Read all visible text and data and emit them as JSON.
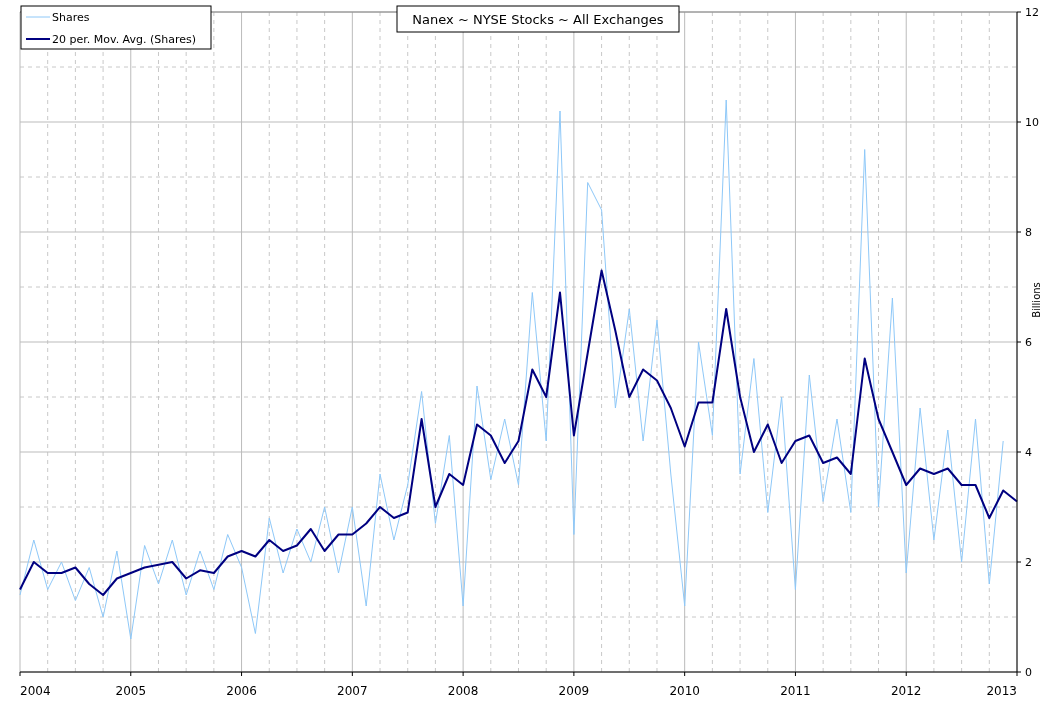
{
  "chart_data": {
    "type": "line",
    "title": "Nanex ~ NYSE Stocks ~ All Exchanges",
    "ylabel": "Billions",
    "x": [
      2004,
      2004.125,
      2004.25,
      2004.375,
      2004.5,
      2004.625,
      2004.75,
      2004.875,
      2005,
      2005.125,
      2005.25,
      2005.375,
      2005.5,
      2005.625,
      2005.75,
      2005.875,
      2006,
      2006.125,
      2006.25,
      2006.375,
      2006.5,
      2006.625,
      2006.75,
      2006.875,
      2007,
      2007.125,
      2007.25,
      2007.375,
      2007.5,
      2007.625,
      2007.75,
      2007.875,
      2008,
      2008.125,
      2008.25,
      2008.375,
      2008.5,
      2008.625,
      2008.75,
      2008.875,
      2009,
      2009.125,
      2009.25,
      2009.375,
      2009.5,
      2009.625,
      2009.75,
      2009.875,
      2010,
      2010.125,
      2010.25,
      2010.375,
      2010.5,
      2010.625,
      2010.75,
      2010.875,
      2011,
      2011.125,
      2011.25,
      2011.375,
      2011.5,
      2011.625,
      2011.75,
      2011.875,
      2012,
      2012.125,
      2012.25,
      2012.375,
      2012.5,
      2012.625,
      2012.75,
      2012.875,
      2013
    ],
    "series": [
      {
        "name": "Shares",
        "color": "#8ec8f8",
        "values": [
          1.4,
          2.4,
          1.5,
          2.0,
          1.3,
          1.9,
          1.0,
          2.2,
          0.6,
          2.3,
          1.6,
          2.4,
          1.4,
          2.2,
          1.5,
          2.5,
          1.9,
          0.7,
          2.8,
          1.8,
          2.6,
          2.0,
          3.0,
          1.8,
          3.0,
          1.2,
          3.6,
          2.4,
          3.4,
          5.1,
          2.7,
          4.3,
          1.2,
          5.2,
          3.5,
          4.6,
          3.4,
          6.9,
          4.2,
          10.2,
          2.5,
          8.9,
          8.4,
          4.8,
          6.6,
          4.2,
          6.4,
          3.6,
          1.2,
          6.0,
          4.3,
          10.4,
          3.6,
          5.7,
          2.9,
          5.0,
          1.5,
          5.4,
          3.1,
          4.6,
          2.9,
          9.5,
          3.0,
          6.8,
          1.8,
          4.8,
          2.4,
          4.4,
          2.0,
          4.6,
          1.6,
          4.2,
          null
        ]
      },
      {
        "name": "20 per. Mov. Avg. (Shares)",
        "color": "#000080",
        "values": [
          1.5,
          2.0,
          1.8,
          1.8,
          1.9,
          1.6,
          1.4,
          1.7,
          1.8,
          1.9,
          1.95,
          2.0,
          1.7,
          1.85,
          1.8,
          2.1,
          2.2,
          2.1,
          2.4,
          2.2,
          2.3,
          2.6,
          2.2,
          2.5,
          2.5,
          2.7,
          3.0,
          2.8,
          2.9,
          4.6,
          3.0,
          3.6,
          3.4,
          4.5,
          4.3,
          3.8,
          4.2,
          5.5,
          5.0,
          6.9,
          4.3,
          5.8,
          7.3,
          6.2,
          5.0,
          5.5,
          5.3,
          4.8,
          4.1,
          4.9,
          4.9,
          6.6,
          5.0,
          4.0,
          4.5,
          3.8,
          4.2,
          4.3,
          3.8,
          3.9,
          3.6,
          5.7,
          4.6,
          4.0,
          3.4,
          3.7,
          3.6,
          3.7,
          3.4,
          3.4,
          2.8,
          3.3,
          3.1
        ]
      }
    ],
    "grid": true,
    "legend": true,
    "xlim": [
      2004,
      2013
    ],
    "ylim": [
      0,
      12
    ],
    "xticks": [
      2004,
      2005,
      2006,
      2007,
      2008,
      2009,
      2010,
      2011,
      2012,
      2013
    ],
    "yticks": [
      0,
      2,
      4,
      6,
      8,
      10,
      12
    ]
  }
}
